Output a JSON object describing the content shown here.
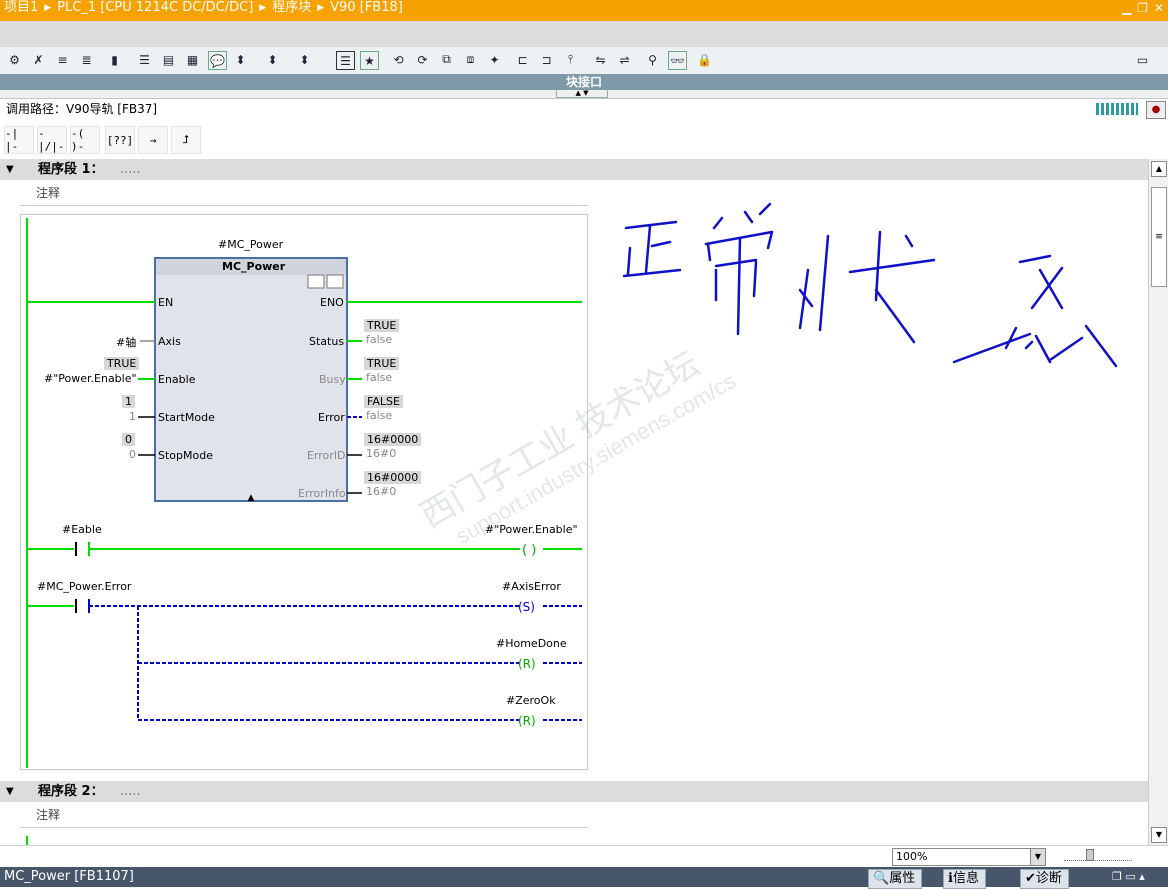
{
  "titlebar": {
    "crumbs": [
      "项目1",
      "PLC_1 [CPU 1214C DC/DC/DC]",
      "程序块",
      "V90 [FB18]"
    ],
    "window_buttons": [
      "minimize-icon",
      "restore-icon",
      "close-icon"
    ]
  },
  "block_interface_label": "块接口",
  "call_path": "调用路径：V90导轨 [FB37]",
  "palette": [
    "-| |-",
    "-|/|-",
    "-( )-",
    "[??]",
    "→",
    "⮥"
  ],
  "networks": [
    {
      "title": "程序段 1：",
      "dots": ".....",
      "comment": "注释"
    },
    {
      "title": "程序段 2：",
      "dots": ".....",
      "comment": "注释"
    }
  ],
  "fb": {
    "instance": "#MC_Power",
    "type": "MC_Power",
    "inputs": [
      {
        "pin": "EN",
        "signal": "",
        "value": "",
        "value2": ""
      },
      {
        "pin": "Axis",
        "signal": "#轴",
        "value": "",
        "value2": ""
      },
      {
        "pin": "Enable",
        "signal": "#\"Power.Enable\"",
        "value": "TRUE",
        "value2": ""
      },
      {
        "pin": "StartMode",
        "signal": "",
        "value": "1",
        "value2": "1"
      },
      {
        "pin": "StopMode",
        "signal": "",
        "value": "0",
        "value2": "0"
      }
    ],
    "outputs": [
      {
        "pin": "ENO",
        "value": "",
        "value2": ""
      },
      {
        "pin": "Status",
        "value": "TRUE",
        "value2": "false"
      },
      {
        "pin": "Busy",
        "value": "TRUE",
        "value2": "false"
      },
      {
        "pin": "Error",
        "value": "FALSE",
        "value2": "false"
      },
      {
        "pin": "ErrorID",
        "value": "16#0000",
        "value2": "16#0"
      },
      {
        "pin": "ErrorInfo",
        "value": "16#0000",
        "value2": "16#0"
      }
    ]
  },
  "rungs": [
    {
      "contact": "#Eable",
      "coil": "#\"Power.Enable\"",
      "coil_type": ""
    },
    {
      "contact": "#MC_Power.Error",
      "coil": "#AxisError",
      "coil_type": "S"
    },
    {
      "coil": "#HomeDone",
      "coil_type": "R"
    },
    {
      "coil": "#ZeroOk",
      "coil_type": "R"
    }
  ],
  "handwriting": "正常状态",
  "watermark": {
    "line1": "西门子工业 技术论坛",
    "line2": "support.industry.siemens.com/cs"
  },
  "zoom": "100%",
  "status_bar": {
    "left": "MC_Power [FB1107]",
    "tabs": [
      "属性",
      "信息",
      "诊断"
    ]
  },
  "colors": {
    "titlebar": "#f6a200",
    "powerflow": "#00dd00",
    "notflowing": "#0000cc",
    "header_band": "#dcdcdc"
  }
}
